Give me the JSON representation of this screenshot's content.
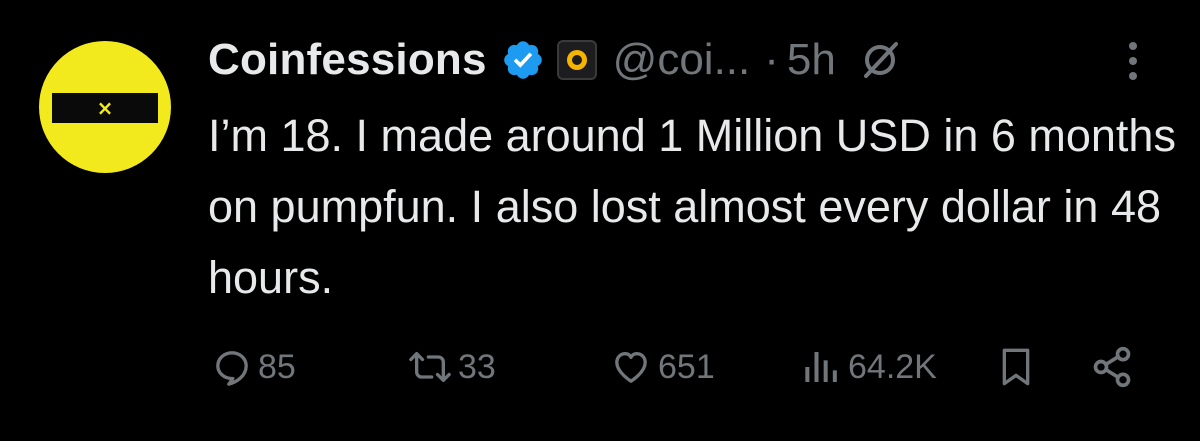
{
  "post": {
    "display_name": "Coinfessions",
    "handle": "@coi...",
    "separator": "·",
    "time": "5h",
    "text": "I’m 18. I made around 1 Million USD in 6 months on pumpfun. I also lost almost every dollar in 48 hours.",
    "avatar_mark": "×"
  },
  "metrics": {
    "replies": "85",
    "reposts": "33",
    "likes": "651",
    "views": "64.2K"
  },
  "icons": {
    "verified": "verified-badge-icon",
    "affiliation": "affiliate-badge-icon",
    "grok": "grok-icon",
    "more": "more-icon",
    "reply": "reply-icon",
    "repost": "repost-icon",
    "like": "like-icon",
    "views": "views-icon",
    "bookmark": "bookmark-icon",
    "share": "share-icon"
  },
  "colors": {
    "background": "#000000",
    "text_primary": "#e7e9ea",
    "text_secondary": "#71767b",
    "verified_blue": "#1d9bf0",
    "avatar_yellow": "#f2ea1c"
  }
}
